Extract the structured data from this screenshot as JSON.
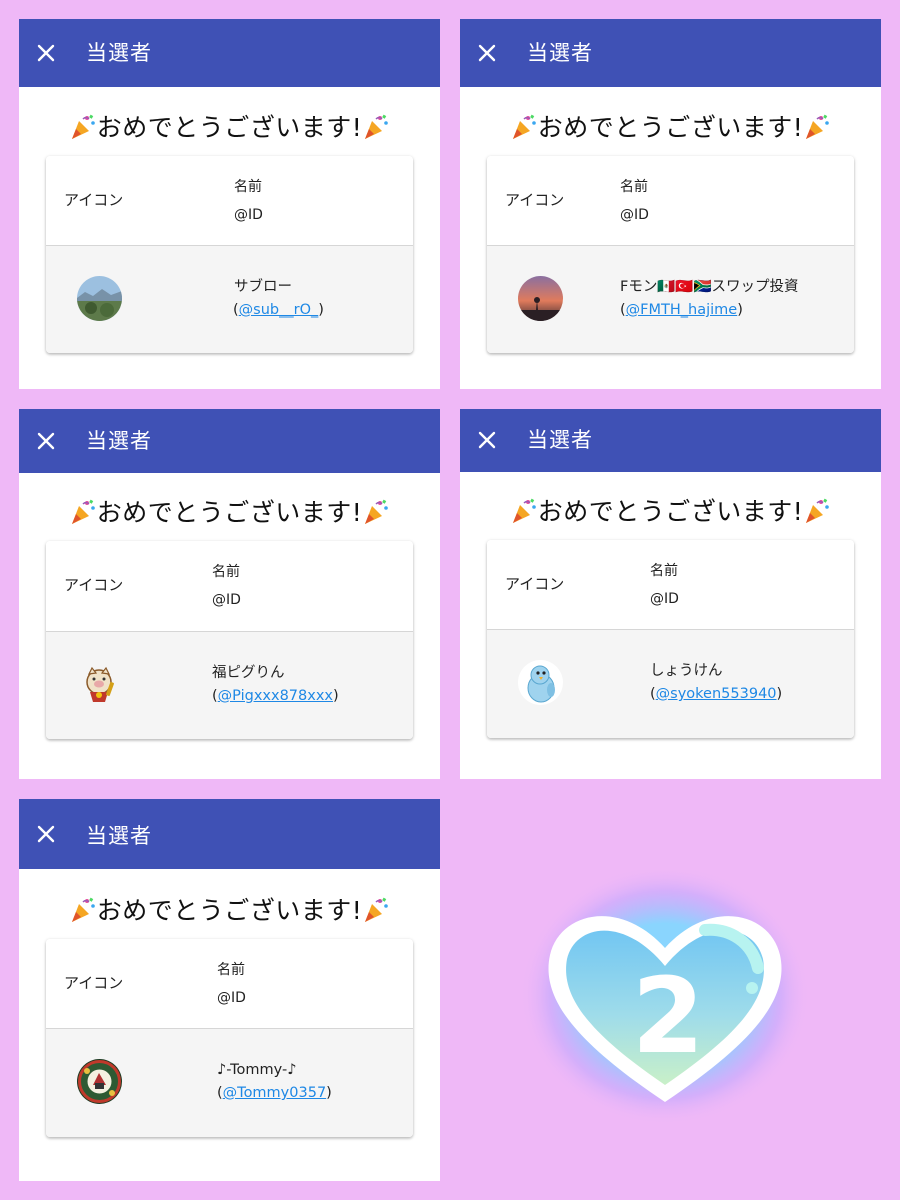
{
  "panels": [
    {
      "title": "当選者",
      "congrats": "おめでとうございます!",
      "header_icon_label": "アイコン",
      "header_name_label": "名前",
      "header_id_label": "@ID",
      "winner_name": "サブロー",
      "winner_id": "@sub__rO_",
      "avatar": "landscape-photo"
    },
    {
      "title": "当選者",
      "congrats": "おめでとうございます!",
      "header_icon_label": "アイコン",
      "header_name_label": "名前",
      "header_id_label": "@ID",
      "winner_name": "Fモン🇲🇽🇹🇷🇿🇦スワップ投資",
      "winner_id": "@FMTH_hajime",
      "avatar": "sunset-photo"
    },
    {
      "title": "当選者",
      "congrats": "おめでとうございます!",
      "header_icon_label": "アイコン",
      "header_name_label": "名前",
      "header_id_label": "@ID",
      "winner_name": "福ピグりん",
      "winner_id": "@Pigxxx878xxx",
      "avatar": "lucky-cat-illustration"
    },
    {
      "title": "当選者",
      "congrats": "おめでとうございます!",
      "header_icon_label": "アイコン",
      "header_name_label": "名前",
      "header_id_label": "@ID",
      "winner_name": "しょうけん",
      "winner_id": "@syoken553940",
      "avatar": "blue-bird-illustration"
    },
    {
      "title": "当選者",
      "congrats": "おめでとうございます!",
      "header_icon_label": "アイコン",
      "header_name_label": "名前",
      "header_id_label": "@ID",
      "winner_name": "♪-Tommy-♪",
      "winner_id": "@Tommy0357",
      "avatar": "badge-logo"
    }
  ],
  "heart_badge": {
    "number": "2",
    "icon": "heart-icon"
  },
  "colors": {
    "background": "#efb8f7",
    "appbar": "#3f51b5",
    "link": "#1e88e5"
  }
}
